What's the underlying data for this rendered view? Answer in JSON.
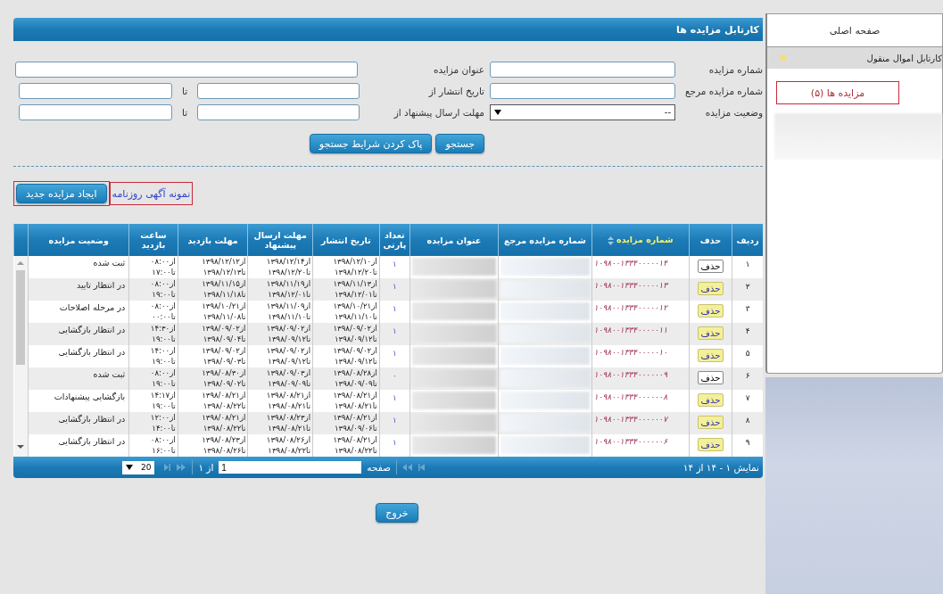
{
  "sidebar": {
    "home": "صفحه اصلی",
    "section": "کارتابل اموال منقول",
    "items": [
      {
        "label": "مزایده ها (۵)",
        "selected": true
      }
    ]
  },
  "panel": {
    "title": "کارتابل مزایده ها"
  },
  "search_rows": [
    {
      "right": {
        "label": "شماره مزایده",
        "kind": "text"
      },
      "left": {
        "label": "عنوان مزایده",
        "kind": "text"
      }
    },
    {
      "right": {
        "label": "شماره مزایده مرجع",
        "kind": "text"
      },
      "left": {
        "label": "تاریخ انتشار از",
        "kind": "range",
        "to_label": "تا"
      }
    },
    {
      "right": {
        "label": "وضعیت مزایده",
        "kind": "select",
        "value": "--"
      },
      "left": {
        "label": "مهلت ارسال پیشنهاد از",
        "kind": "range",
        "to_label": "تا"
      }
    }
  ],
  "search_buttons": [
    "جستجو",
    "پاک کردن شرایط جستجو"
  ],
  "actions": {
    "create_button": "ایجاد مزایده جدید",
    "newspaper_link": "نمونه آگهی روزنامه"
  },
  "table": {
    "columns": [
      {
        "label": "ردیف",
        "sorted": false
      },
      {
        "label": "حذف",
        "sorted": false
      },
      {
        "label": "شماره مزایده",
        "sorted": true
      },
      {
        "label": "شماره مزایده مرجع",
        "sorted": false
      },
      {
        "label": "عنوان مزایده",
        "sorted": false
      },
      {
        "label": "تعداد پارتی",
        "sorted": false
      },
      {
        "label": "تاریخ انتشار",
        "sorted": false
      },
      {
        "label": "مهلت ارسال پیشنهاد",
        "sorted": false
      },
      {
        "label": "مهلت بازدید",
        "sorted": false
      },
      {
        "label": "ساعت بازدید",
        "sorted": false
      },
      {
        "label": "وضعیت مزایده",
        "sorted": false
      }
    ],
    "rows": [
      {
        "index": "۱",
        "delete": {
          "label": "حذف",
          "highlighted": false
        },
        "number": "۱۰۹۸۰۰۱۳۳۴۰۰۰۰۰۱۴",
        "party_count": "۱",
        "publish": [
          "از۱۳۹۸/۱۲/۱۰",
          "تا۱۳۹۸/۱۲/۲۰"
        ],
        "offer_deadline": [
          "از۱۳۹۸/۱۲/۱۴",
          "تا۱۳۹۸/۱۲/۲۰"
        ],
        "visit_deadline": [
          "از۱۳۹۸/۱۲/۱۲",
          "تا۱۳۹۸/۱۲/۱۳"
        ],
        "visit_time": [
          "از۰۸:۰۰",
          "تا۱۷:۰۰"
        ],
        "status": "ثبت شده"
      },
      {
        "index": "۲",
        "delete": {
          "label": "حذف",
          "highlighted": true
        },
        "number": "۱۰۹۸۰۰۱۳۳۴۰۰۰۰۰۱۳",
        "party_count": "۱",
        "publish": [
          "از۱۳۹۸/۱۱/۱۳",
          "تا۱۳۹۸/۱۲/۰۱"
        ],
        "offer_deadline": [
          "از۱۳۹۸/۱۱/۱۹",
          "تا۱۳۹۸/۱۲/۰۱"
        ],
        "visit_deadline": [
          "از۱۳۹۸/۱۱/۱۵",
          "تا۱۳۹۸/۱۱/۱۸"
        ],
        "visit_time": [
          "از۰۸:۰۰",
          "تا۱۹:۰۰"
        ],
        "status": "در انتظار تایید"
      },
      {
        "index": "۳",
        "delete": {
          "label": "حذف",
          "highlighted": true
        },
        "number": "۱۰۹۸۰۰۱۳۳۴۰۰۰۰۰۱۲",
        "party_count": "۱",
        "publish": [
          "از۱۳۹۸/۱۰/۲۱",
          "تا۱۳۹۸/۱۱/۱۰"
        ],
        "offer_deadline": [
          "از۱۳۹۸/۱۱/۰۹",
          "تا۱۳۹۸/۱۱/۱۰"
        ],
        "visit_deadline": [
          "از۱۳۹۸/۱۰/۲۱",
          "تا۱۳۹۸/۱۱/۰۸"
        ],
        "visit_time": [
          "از۰۸:۰۰",
          "تا۰۰:۰۰"
        ],
        "status": "در مرحله اصلاحات"
      },
      {
        "index": "۴",
        "delete": {
          "label": "حذف",
          "highlighted": true
        },
        "number": "۱۰۹۸۰۰۱۳۳۴۰۰۰۰۰۱۱",
        "party_count": "۱",
        "publish": [
          "از۱۳۹۸/۰۹/۰۲",
          "تا۱۳۹۸/۰۹/۱۲"
        ],
        "offer_deadline": [
          "از۱۳۹۸/۰۹/۰۲",
          "تا۱۳۹۸/۰۹/۱۲"
        ],
        "visit_deadline": [
          "از۱۳۹۸/۰۹/۰۲",
          "تا۱۳۹۸/۰۹/۰۴"
        ],
        "visit_time": [
          "از۱۴:۳۰",
          "تا۱۹:۰۰"
        ],
        "status": "در انتظار بازگشایی"
      },
      {
        "index": "۵",
        "delete": {
          "label": "حذف",
          "highlighted": true
        },
        "number": "۱۰۹۸۰۰۱۳۳۴۰۰۰۰۰۱۰",
        "party_count": "۱",
        "publish": [
          "از۱۳۹۸/۰۹/۰۲",
          "تا۱۳۹۸/۰۹/۱۲"
        ],
        "offer_deadline": [
          "از۱۳۹۸/۰۹/۰۲",
          "تا۱۳۹۸/۰۹/۱۲"
        ],
        "visit_deadline": [
          "از۱۳۹۸/۰۹/۰۲",
          "تا۱۳۹۸/۰۹/۰۳"
        ],
        "visit_time": [
          "از۱۴:۰۰",
          "تا۱۹:۰۰"
        ],
        "status": "در انتظار بازگشایی"
      },
      {
        "index": "۶",
        "delete": {
          "label": "حذف",
          "highlighted": false
        },
        "number": "۱۰۹۸۰۰۱۳۳۴۰۰۰۰۰۰۹",
        "party_count": "۰",
        "publish": [
          "از۱۳۹۸/۰۸/۲۸",
          "تا۱۳۹۸/۰۹/۰۹"
        ],
        "offer_deadline": [
          "از۱۳۹۸/۰۹/۰۳",
          "تا۱۳۹۸/۰۹/۰۹"
        ],
        "visit_deadline": [
          "از۱۳۹۸/۰۸/۳۰",
          "تا۱۳۹۸/۰۹/۰۲"
        ],
        "visit_time": [
          "از۰۸:۰۰",
          "تا۱۹:۰۰"
        ],
        "status": "ثبت شده"
      },
      {
        "index": "۷",
        "delete": {
          "label": "حذف",
          "highlighted": true
        },
        "number": "۱۰۹۸۰۰۱۳۳۴۰۰۰۰۰۰۸",
        "party_count": "۱",
        "publish": [
          "از۱۳۹۸/۰۸/۲۱",
          "تا۱۳۹۸/۰۸/۲۱"
        ],
        "offer_deadline": [
          "از۱۳۹۸/۰۸/۲۱",
          "تا۱۳۹۸/۰۸/۲۱"
        ],
        "visit_deadline": [
          "از۱۳۹۸/۰۸/۲۱",
          "تا۱۳۹۸/۰۸/۲۲"
        ],
        "visit_time": [
          "از۱۴:۱۷",
          "تا۱۹:۰۰"
        ],
        "status": "بازگشایی پیشنهادات"
      },
      {
        "index": "۸",
        "delete": {
          "label": "حذف",
          "highlighted": true
        },
        "number": "۱۰۹۸۰۰۱۳۳۴۰۰۰۰۰۰۷",
        "party_count": "۱",
        "publish": [
          "از۱۳۹۸/۰۸/۲۱",
          "تا۱۳۹۸/۰۹/۰۶"
        ],
        "offer_deadline": [
          "از۱۳۹۸/۰۸/۲۳",
          "تا۱۳۹۸/۰۸/۲۱"
        ],
        "visit_deadline": [
          "از۱۳۹۸/۰۸/۲۱",
          "تا۱۳۹۸/۰۸/۲۲"
        ],
        "visit_time": [
          "از۱۲:۰۰",
          "تا۱۴:۰۰"
        ],
        "status": "در انتظار بازگشایی"
      },
      {
        "index": "۹",
        "delete": {
          "label": "حذف",
          "highlighted": true
        },
        "number": "۱۰۹۸۰۰۱۳۳۴۰۰۰۰۰۰۶",
        "party_count": "۱",
        "publish": [
          "از۱۳۹۸/۰۸/۲۱",
          "تا۱۳۹۸/۰۸/۲۲"
        ],
        "offer_deadline": [
          "از۱۳۹۸/۰۸/۲۶",
          "تا۱۳۹۸/۰۸/۲۲"
        ],
        "visit_deadline": [
          "از۱۳۹۸/۰۸/۲۳",
          "تا۱۳۹۸/۰۸/۲۶"
        ],
        "visit_time": [
          "از۰۸:۰۰",
          "تا۱۶:۰۰"
        ],
        "status": "در انتظار بازگشایی"
      }
    ]
  },
  "pager": {
    "summary": "نمایش ۱ - ۱۴ از ۱۴",
    "page_label": "صفحه",
    "page_value": "1",
    "of_label": "از ۱",
    "page_size": "20"
  },
  "exit_button": "خروج"
}
